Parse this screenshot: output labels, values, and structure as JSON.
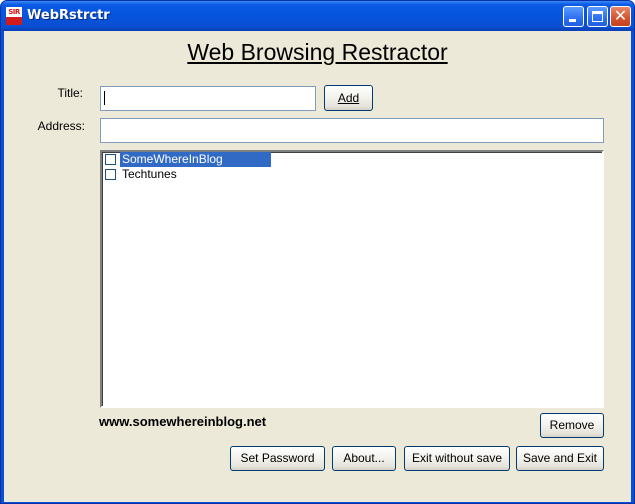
{
  "window": {
    "title": "WebRstrctr",
    "icon_text": "SIR"
  },
  "heading": "Web Browsing Restractor",
  "form": {
    "title_label": "Title:",
    "title_value": "",
    "address_label": "Address:",
    "address_value": "",
    "add_button": "Add"
  },
  "list": {
    "items": [
      {
        "label": "SomeWhereInBlog",
        "checked": false,
        "selected": true
      },
      {
        "label": "Techtunes",
        "checked": false,
        "selected": false
      }
    ]
  },
  "website": "www.somewhereinblog.net",
  "buttons": {
    "remove": "Remove",
    "set_password": "Set Password",
    "about": "About...",
    "exit_without_save": "Exit without save",
    "save_and_exit": "Save and Exit"
  },
  "colors": {
    "titlebar": "#0a5ae6",
    "client_bg": "#ece9d8",
    "selection": "#316ac5",
    "close_button": "#d5522d"
  }
}
